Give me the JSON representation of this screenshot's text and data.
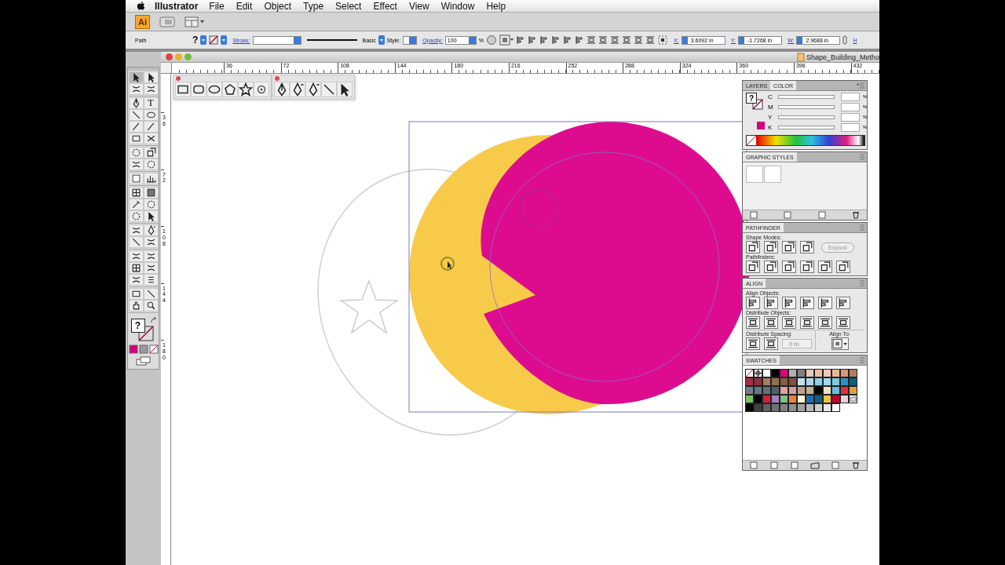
{
  "menu_bar": {
    "app": "Illustrator",
    "items": [
      "File",
      "Edit",
      "Object",
      "Type",
      "Select",
      "Effect",
      "View",
      "Window",
      "Help"
    ]
  },
  "app_bar": {
    "logo": "Ai"
  },
  "control_bar": {
    "selection": "Path",
    "fill": "?",
    "stroke_label": "Stroke:",
    "stroke_profile": "Basic",
    "style_label": "Style:",
    "opacity_label": "Opacity:",
    "opacity": "100",
    "opacity_unit": "%",
    "x_label": "X:",
    "x": "3.6092 in",
    "y_label": "Y:",
    "y": "-1.7268 in",
    "w_label": "W:",
    "w": "2.9688 in",
    "h_label": "H"
  },
  "document": {
    "title": "Shape_Building_Metho",
    "ruler_h": [
      "36",
      "72",
      "108",
      "144",
      "180",
      "216",
      "252",
      "288",
      "324",
      "360",
      "396",
      "432"
    ],
    "ruler_v": [
      "36",
      "72",
      "108",
      "144",
      "180"
    ]
  },
  "tools_panel": {
    "type_tool": "T",
    "fill": "?"
  },
  "color_panel": {
    "tabs": [
      {
        "label": "LAYERS",
        "selected": false
      },
      {
        "label": "COLOR",
        "selected": true
      }
    ],
    "channels": [
      {
        "name": "C",
        "unit": "%"
      },
      {
        "name": "M",
        "unit": "%"
      },
      {
        "name": "Y",
        "unit": "%"
      },
      {
        "name": "K",
        "unit": "%"
      }
    ]
  },
  "graphic_styles_panel": {
    "title": "GRAPHIC STYLES"
  },
  "pathfinder_panel": {
    "title": "PATHFINDER",
    "shape_modes": "Shape Modes:",
    "expand": "Expand",
    "pathfinders": "Pathfinders:"
  },
  "align_panel": {
    "title": "ALIGN",
    "align_objects": "Align Objects:",
    "distribute_objects": "Distribute Objects:",
    "distribute_spacing": "Distribute Spacing:",
    "align_to": "Align To:",
    "spacing": "0 in"
  },
  "swatches_panel": {
    "title": "SWATCHES",
    "swatches": [
      {
        "color": "#ffffff"
      },
      {
        "color": "#000000"
      },
      {
        "color": "#e0007a"
      },
      {
        "color": "#b0b0b0"
      },
      {
        "color": "#808080"
      },
      {
        "color": "#e8c8b8"
      },
      {
        "color": "#e8c0a8"
      },
      {
        "color": "#f0c8b8"
      },
      {
        "color": "#e8b898"
      },
      {
        "color": "#d89878"
      },
      {
        "color": "#b08060"
      },
      {
        "color": "#a03040"
      },
      {
        "color": "#903040"
      },
      {
        "color": "#a08060"
      },
      {
        "color": "#907050"
      },
      {
        "color": "#806040"
      },
      {
        "color": "#805040"
      },
      {
        "color": "#c0e0e8"
      },
      {
        "color": "#a8d8e8"
      },
      {
        "color": "#90d0e8"
      },
      {
        "color": "#a0d8f0"
      },
      {
        "color": "#80c8e0"
      },
      {
        "color": "#3090c0"
      },
      {
        "color": "#106080"
      },
      {
        "color": "#708088"
      },
      {
        "color": "#607880"
      },
      {
        "color": "#607080"
      },
      {
        "color": "#506068"
      },
      {
        "color": "#e0a0a0"
      },
      {
        "color": "#d0a0a0"
      },
      {
        "color": "#c0a090"
      },
      {
        "color": "#c0b090"
      },
      {
        "color": "#000000"
      },
      {
        "color": "#f0e0c0"
      },
      {
        "color": "#60c0e0"
      },
      {
        "color": "#e03040"
      },
      {
        "color": "#e0a040"
      },
      {
        "color": "#80c060"
      },
      {
        "color": "#000000"
      },
      {
        "color": "#d02040"
      },
      {
        "color": "#a080c0"
      },
      {
        "color": "#80c080"
      },
      {
        "color": "#f08040"
      },
      {
        "color": "#fff8d0"
      },
      {
        "color": "#2070b0"
      },
      {
        "color": "#106080"
      },
      {
        "color": "#f0c040"
      },
      {
        "color": "#c00030"
      },
      {
        "color": "#f0d0d8"
      }
    ],
    "grays": [
      {
        "color": "#000000"
      },
      {
        "color": "#404040"
      },
      {
        "color": "#606060"
      },
      {
        "color": "#707070"
      },
      {
        "color": "#808080"
      },
      {
        "color": "#909090"
      },
      {
        "color": "#a0a0a0"
      },
      {
        "color": "#b8b8b8"
      },
      {
        "color": "#d0d0d0"
      },
      {
        "color": "#e8e8e8"
      },
      {
        "color": "#ffffff"
      }
    ]
  }
}
